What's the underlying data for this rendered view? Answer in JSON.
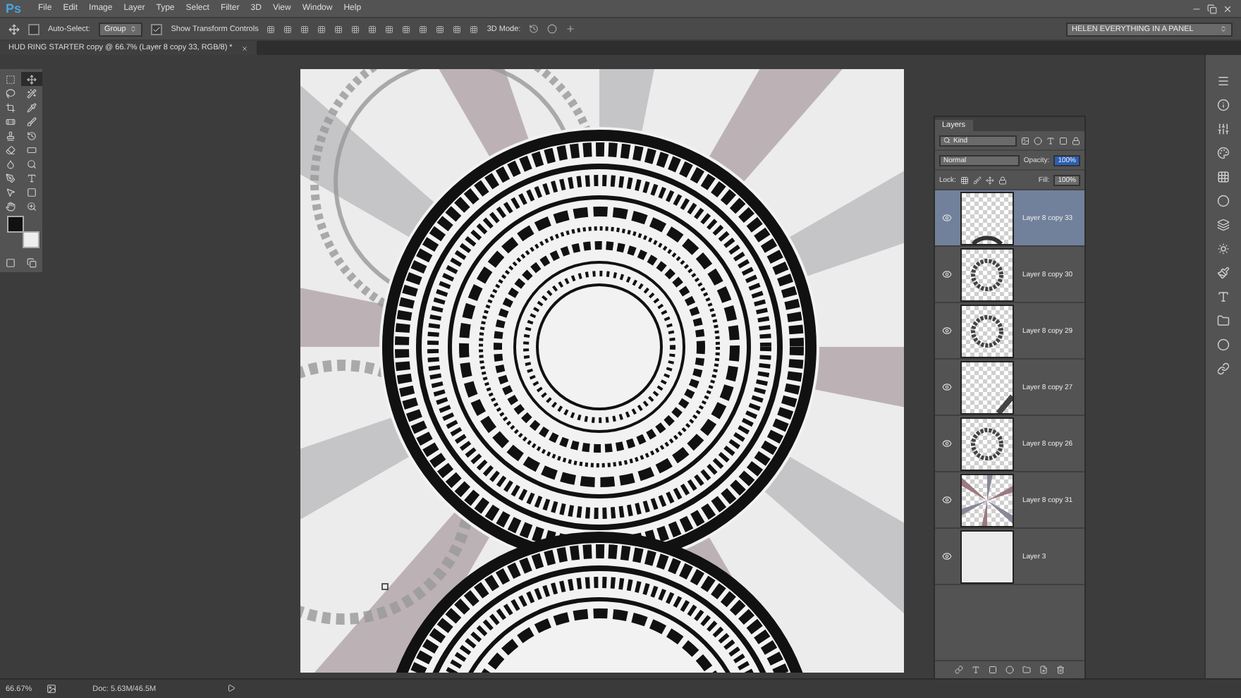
{
  "app": {
    "logo": "Ps",
    "menus": [
      "File",
      "Edit",
      "Image",
      "Layer",
      "Type",
      "Select",
      "Filter",
      "3D",
      "View",
      "Window",
      "Help"
    ]
  },
  "options_bar": {
    "auto_select": {
      "label": "Auto-Select:",
      "checked": false
    },
    "auto_select_target": "Group",
    "show_transform": {
      "label": "Show Transform Controls",
      "checked": true
    },
    "mode_label": "3D Mode:",
    "workspace": "HELEN EVERYTHING IN A PANEL"
  },
  "document_tab": {
    "title": "HUD RING STARTER copy @ 66.7% (Layer 8 copy 33, RGB/8) *"
  },
  "tools": [
    {
      "kind": "marquee",
      "selected": false
    },
    {
      "kind": "move",
      "selected": true
    },
    {
      "kind": "lasso",
      "selected": false
    },
    {
      "kind": "wand",
      "selected": false
    },
    {
      "kind": "crop",
      "selected": false
    },
    {
      "kind": "pipette",
      "selected": false
    },
    {
      "kind": "bandage",
      "selected": false
    },
    {
      "kind": "brush",
      "selected": false
    },
    {
      "kind": "stamp",
      "selected": false
    },
    {
      "kind": "history",
      "selected": false
    },
    {
      "kind": "eraser",
      "selected": false
    },
    {
      "kind": "gradient",
      "selected": false
    },
    {
      "kind": "droplet",
      "selected": false
    },
    {
      "kind": "dodge",
      "selected": false
    },
    {
      "kind": "pen",
      "selected": false
    },
    {
      "kind": "type",
      "selected": false
    },
    {
      "kind": "pointer",
      "selected": false
    },
    {
      "kind": "rectangle",
      "selected": false
    },
    {
      "kind": "hand",
      "selected": false
    },
    {
      "kind": "zoom",
      "selected": false
    }
  ],
  "layers_panel": {
    "title": "Layers",
    "filter": "Kind",
    "blend_mode": "Normal",
    "opacity_label": "Opacity:",
    "opacity": "100%",
    "lock_label": "Lock:",
    "fill_label": "Fill:",
    "fill": "100%",
    "layers": [
      {
        "name": "Layer 8 copy 33",
        "selected": true,
        "visible": true,
        "kind": "arc"
      },
      {
        "name": "Layer 8 copy 30",
        "selected": false,
        "visible": true,
        "kind": "ring"
      },
      {
        "name": "Layer 8 copy 29",
        "selected": false,
        "visible": true,
        "kind": "ring"
      },
      {
        "name": "Layer 8 copy 27",
        "selected": false,
        "visible": true,
        "kind": "corner"
      },
      {
        "name": "Layer 8 copy 26",
        "selected": false,
        "visible": true,
        "kind": "ring"
      },
      {
        "name": "Layer 8 copy 31",
        "selected": false,
        "visible": true,
        "kind": "rays"
      },
      {
        "name": "Layer 3",
        "selected": false,
        "visible": true,
        "kind": "solid"
      }
    ]
  },
  "status_bar": {
    "zoom": "66.67%",
    "doc": "Doc: 5.63M/46.5M"
  }
}
